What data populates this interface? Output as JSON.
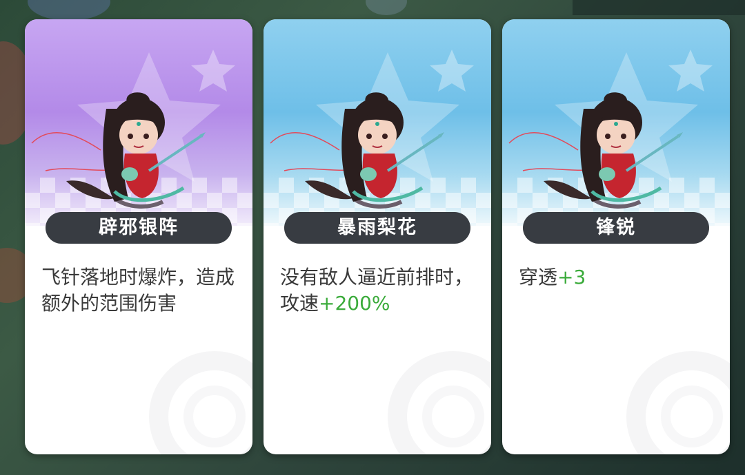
{
  "cards": [
    {
      "name": "辟邪银阵",
      "theme": "purple",
      "description": "飞针落地时爆炸，造成额外的范围伤害"
    },
    {
      "name": "暴雨梨花",
      "theme": "blue",
      "description_prefix": "没有敌人逼近前排时，攻速",
      "description_bonus": "+200%"
    },
    {
      "name": "锋锐",
      "theme": "blue",
      "description_prefix": "穿透",
      "description_bonus": "+3"
    }
  ],
  "colors": {
    "purple_card": "#b38ae8",
    "blue_card": "#6ebfe8",
    "name_pill": "#383c42",
    "bonus_text": "#3bab3b",
    "body_text": "#3a3a3a"
  },
  "icons": [
    "star-icon",
    "hero-portrait-icon",
    "needle-icon"
  ]
}
